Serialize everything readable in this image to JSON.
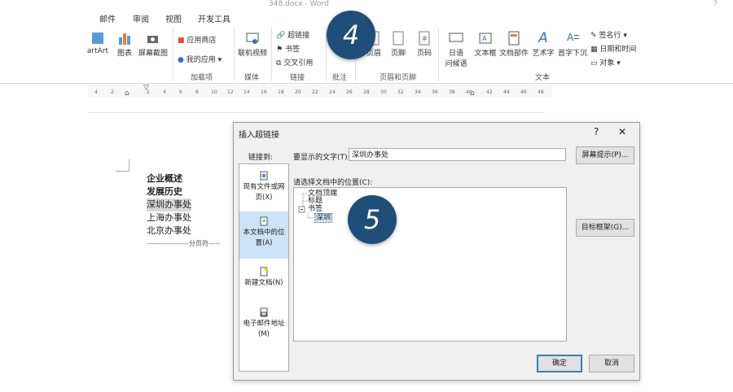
{
  "window": {
    "title": "348.docx - Word",
    "help": "?"
  },
  "menu_tabs": [
    "邮件",
    "审阅",
    "视图",
    "开发工具"
  ],
  "ribbon": {
    "smartart": "artArt",
    "chart": "图表",
    "screenshot": "屏幕截图",
    "app_store": "应用商店",
    "my_apps": "我的应用",
    "online_video": "联机视频",
    "hyperlink": "超链接",
    "bookmark": "书签",
    "cross_ref": "交叉引用",
    "header": "页眉",
    "footer": "页脚",
    "page_num": "页码",
    "japanese_greeting_1": "日语",
    "japanese_greeting_2": "问候语",
    "textbox": "文本框",
    "doc_parts": "文档部件",
    "wordart": "艺术字",
    "dropcap": "首字下沉",
    "signature_line": "签名行",
    "date_time": "日期和时间",
    "object": "对象",
    "groups": {
      "addins": "加载项",
      "media": "媒体",
      "links": "链接",
      "comments": "批注",
      "header_footer": "页眉和页脚",
      "text": "文本"
    }
  },
  "ruler_numbers": [
    "4",
    "2",
    "2",
    "4",
    "6",
    "8",
    "10",
    "12",
    "14",
    "16",
    "18",
    "20",
    "22",
    "24",
    "26",
    "28",
    "30",
    "32",
    "34",
    "36",
    "38",
    "40",
    "42",
    "44",
    "46",
    "48"
  ],
  "document": {
    "lines": [
      "企业概述",
      "发展历史",
      "深圳办事处",
      "上海办事处",
      "北京办事处"
    ],
    "page_break": "------------------分页符-----"
  },
  "step_bubbles": [
    "4",
    "5"
  ],
  "dialog": {
    "title": "插入超链接",
    "help": "?",
    "close": "✕",
    "link_to_label": "链接到:",
    "display_text_label": "要显示的文字(T):",
    "display_text_value": "深圳办事处",
    "screen_tip_button": "屏幕提示(P)...",
    "place_label": "请选择文档中的位置(C):",
    "nav": [
      {
        "line1": "现有文件或网",
        "line2": "页(X)"
      },
      {
        "line1": "本文档中的位",
        "line2": "置(A)"
      },
      {
        "line1": "新建文档(N)",
        "line2": ""
      },
      {
        "line1": "电子邮件地址",
        "line2": "(M)"
      }
    ],
    "tree": {
      "doc_top": "文档顶端",
      "headings": "标题",
      "bookmarks": "书签",
      "selected_bookmark": "深圳"
    },
    "target_frame_button": "目标框架(G)...",
    "ok_button": "确定",
    "cancel_button": "取消"
  },
  "colors": {
    "bubble": "#1f4e79",
    "nav_active": "#cce3f7",
    "selection": "#cce3f7"
  }
}
